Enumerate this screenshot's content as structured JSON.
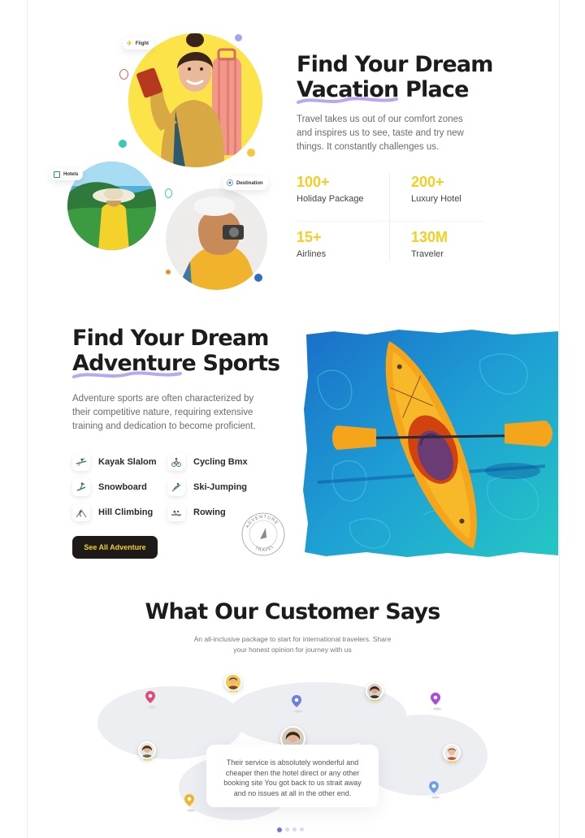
{
  "hero": {
    "title_line1": "Find Your Dream",
    "title_line2": "Vacation Place",
    "description": "Travel takes us out of our comfort zones and inspires us to see, taste and try new things. It constantly challenges us.",
    "tags": {
      "flight": "Flight",
      "hotels": "Hotels",
      "destination": "Destination"
    },
    "stats": [
      {
        "number": "100+",
        "label": "Holiday Package"
      },
      {
        "number": "200+",
        "label": "Luxury Hotel"
      },
      {
        "number": "15+",
        "label": "Airlines"
      },
      {
        "number": "130M",
        "label": "Traveler"
      }
    ]
  },
  "adventure": {
    "title_line1": "Find Your Dream",
    "title_line2": "Adventure Sports",
    "description": "Adventure sports are often characterized by their competitive nature, requiring extensive training and dedication to become proficient.",
    "sports": [
      {
        "label": "Kayak Slalom",
        "icon": "kayak-slalom-icon"
      },
      {
        "label": "Cycling Bmx",
        "icon": "cycling-bmx-icon"
      },
      {
        "label": "Snowboard",
        "icon": "snowboard-icon"
      },
      {
        "label": "Ski-Jumping",
        "icon": "ski-jumping-icon"
      },
      {
        "label": "Hill Climbing",
        "icon": "hill-climbing-icon"
      },
      {
        "label": "Rowing",
        "icon": "rowing-icon"
      }
    ],
    "button_label": "See All Adventure",
    "stamp_top": "ADVENTURE",
    "stamp_bottom": "TRAVEL"
  },
  "testimonials": {
    "title": "What Our Customer Says",
    "subtitle_line1": "An all-inclusive package to start for international travelers. Share",
    "subtitle_line2": "your honest opinion for journey with us",
    "quote_line1": "Their service is absolutely wonderful and",
    "quote_line2": "cheaper then the hotel direct or any other",
    "quote_line3": "booking site You got back to us strait away",
    "quote_line4": "and no issues at all in the other end.",
    "carousel_pages": 4,
    "active_page": 1
  },
  "colors": {
    "accent_yellow": "#f2cf20",
    "dark": "#1d1a18",
    "underline_purple": "#b9a8ef",
    "water": "#1f8ec9",
    "kayak": "#f4a51c"
  }
}
